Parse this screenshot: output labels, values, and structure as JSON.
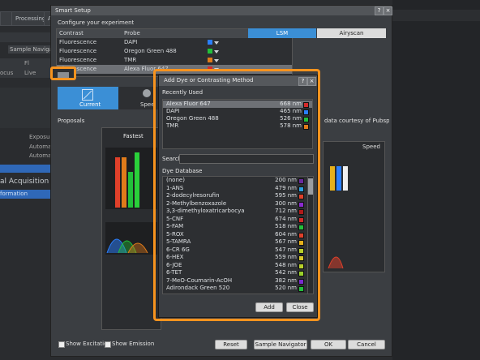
{
  "colors": {
    "accent": "#f7931e",
    "blue": "#3b8fd6",
    "select": "#6e7176"
  },
  "background": {
    "tabs": [
      "",
      "Processing",
      "Ac"
    ],
    "sample_navigator": "Sample Navigator",
    "left_labels": [
      "Fl",
      "Live",
      "Exposure",
      "Automatic",
      "Automatic"
    ],
    "acquisition": "al Acquisition",
    "information": "formation"
  },
  "setup": {
    "title": "Smart Setup",
    "configure_label": "Configure your experiment",
    "col_contrast": "Contrast",
    "col_probe": "Probe",
    "rows": [
      {
        "contrast": "Fluorescence",
        "probe": "DAPI",
        "color": "#2a7fff"
      },
      {
        "contrast": "Fluorescence",
        "probe": "Oregon Green 488",
        "color": "#22c03a"
      },
      {
        "contrast": "Fluorescence",
        "probe": "TMR",
        "color": "#e07b1a"
      },
      {
        "contrast": "Fluorescence",
        "probe": "Alexa Fluor 647",
        "color": "#d42a2a"
      }
    ],
    "lsm": "LSM",
    "airyscan": "Airyscan",
    "current": "Current",
    "speed": "Spee",
    "proposals": "Proposals",
    "courtesy": "data courtesy of Pubspectra",
    "fastest": "Fastest",
    "speed_right": "Speed",
    "show_excitation": "Show Excitation",
    "show_emission": "Show Emission",
    "buttons": {
      "reset": "Reset",
      "sample_navigator": "Sample Navigator",
      "ok": "OK",
      "cancel": "Cancel"
    }
  },
  "dialog": {
    "title": "Add Dye or Contrasting Method",
    "recently_used": "Recently Used",
    "recent": [
      {
        "name": "Alexa Fluor 647",
        "wl": "668 nm",
        "color": "#d42a2a"
      },
      {
        "name": "DAPI",
        "wl": "465 nm",
        "color": "#2a7fff"
      },
      {
        "name": "Oregon Green 488",
        "wl": "526 nm",
        "color": "#22c03a"
      },
      {
        "name": "TMR",
        "wl": "578 nm",
        "color": "#e07b1a"
      }
    ],
    "search_label": "Search",
    "search_value": "",
    "dye_database": "Dye Database",
    "dyes": [
      {
        "name": "(none)",
        "wl": "200 nm",
        "color": "#6a2aa0"
      },
      {
        "name": "1-ANS",
        "wl": "479 nm",
        "color": "#2aa0e0"
      },
      {
        "name": "2-dodecylresorufin",
        "wl": "595 nm",
        "color": "#e0402a"
      },
      {
        "name": "2-Methylbenzoxazole",
        "wl": "300 nm",
        "color": "#8a2ad0"
      },
      {
        "name": "3,3-dimethyloxatricarbocya",
        "wl": "712 nm",
        "color": "#b01a1a"
      },
      {
        "name": "5-CNF",
        "wl": "674 nm",
        "color": "#d42a2a"
      },
      {
        "name": "5-FAM",
        "wl": "518 nm",
        "color": "#22c03a"
      },
      {
        "name": "5-ROX",
        "wl": "604 nm",
        "color": "#e0402a"
      },
      {
        "name": "5-TAMRA",
        "wl": "567 nm",
        "color": "#e6b01a"
      },
      {
        "name": "6-CR 6G",
        "wl": "547 nm",
        "color": "#b8d02a"
      },
      {
        "name": "6-HEX",
        "wl": "559 nm",
        "color": "#d8c82a"
      },
      {
        "name": "6-JOE",
        "wl": "548 nm",
        "color": "#b8d02a"
      },
      {
        "name": "6-TET",
        "wl": "542 nm",
        "color": "#9ad02a"
      },
      {
        "name": "7-MeO-Coumarin-AcOH",
        "wl": "382 nm",
        "color": "#7a2ad0"
      },
      {
        "name": "Adirondack Green 520",
        "wl": "520 nm",
        "color": "#22c03a"
      }
    ],
    "add": "Add",
    "close": "Close"
  }
}
